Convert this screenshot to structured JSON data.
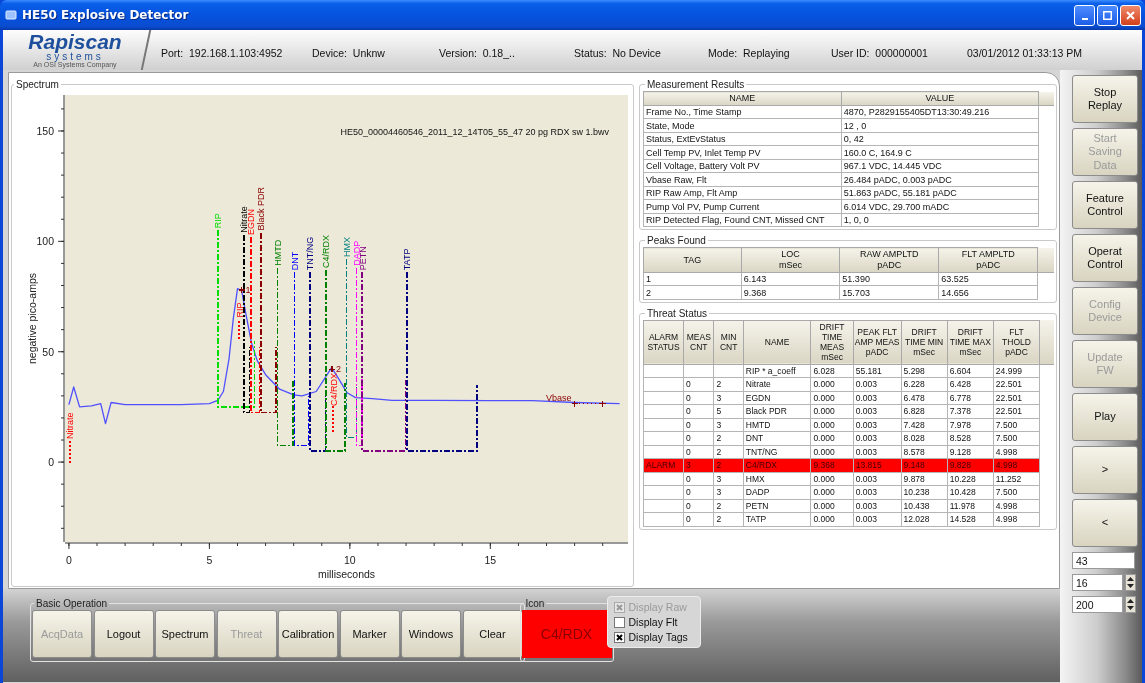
{
  "window": {
    "title": "HE50 Explosive Detector"
  },
  "header": {
    "logo": {
      "name": "Rapiscan",
      "subtitle": "systems",
      "tagline": "An OSI Systems Company"
    },
    "info": [
      "Port:  192.168.1.103:4952",
      "Device:  Unknw",
      "Version:  0.18_..",
      "Status:  No Device",
      "Mode:  Replaying",
      "User ID:  000000001",
      "03/01/2012 01:33:13 PM"
    ]
  },
  "spectrum": {
    "title": "Spectrum",
    "chart_data": {
      "type": "line",
      "title": "HE50_00004460546_2011_12_14T05_55_47 20 pg RDX sw 1.bwv",
      "xlabel": "milliseconds",
      "ylabel": "negative pico-amps",
      "xlim": [
        -0.14,
        19.9
      ],
      "ylim": [
        -36.2,
        166.3
      ],
      "xticks": [
        0,
        5,
        10,
        15
      ],
      "yticks": [
        0,
        50,
        100,
        150
      ],
      "x": [
        0,
        0.17,
        0.38,
        0.8,
        1.13,
        1.3,
        1.5,
        2,
        3,
        4,
        5,
        5.3,
        5.5,
        5.7,
        5.85,
        6,
        6.15,
        6.3,
        6.5,
        6.7,
        7,
        7.5,
        8,
        8.3,
        8.8,
        9.1,
        9.35,
        9.6,
        9.9,
        10.2,
        10.8,
        11.5,
        13,
        15,
        16.5,
        18,
        19.6
      ],
      "series": [
        {
          "color": "#5050ff",
          "values": [
            26,
            34,
            25,
            25.5,
            26.5,
            17.4,
            27,
            26,
            26,
            26,
            26.5,
            28,
            32,
            47,
            65,
            78.6,
            77.7,
            67,
            54,
            46,
            39.6,
            33,
            30.5,
            30,
            32,
            37.8,
            42.8,
            37.8,
            31.4,
            29.2,
            28.7,
            28,
            28,
            27.8,
            27.8,
            27,
            26.5
          ]
        }
      ]
    },
    "markers": [
      {
        "kind": "gate",
        "text": "RIP",
        "color": "#00dd00"
      },
      {
        "kind": "gate",
        "text": "Nitrate",
        "color": "#000000"
      },
      {
        "kind": "gate",
        "text": "EGDN",
        "color": "#ff0000"
      },
      {
        "kind": "gate",
        "text": "Black PDR",
        "color": "#8b0000"
      },
      {
        "kind": "gate",
        "text": "HMTD",
        "color": "#008000"
      },
      {
        "kind": "gate",
        "text": "DNT",
        "color": "#0000ff"
      },
      {
        "kind": "gate",
        "text": "TNT/NG",
        "color": "#000080"
      },
      {
        "kind": "gate",
        "text": "C4/RDX",
        "color": "#008000"
      },
      {
        "kind": "gate",
        "text": "HMX",
        "color": "#008080"
      },
      {
        "kind": "gate",
        "text": "DADP",
        "color": "#ff00ff"
      },
      {
        "kind": "gate",
        "text": "PETN",
        "color": "#800080"
      },
      {
        "kind": "gate",
        "text": "TATP",
        "color": "#000080"
      },
      {
        "kind": "tag",
        "text": "Nitrate",
        "color": "#ff0000"
      },
      {
        "kind": "tag",
        "text": "RIP",
        "color": "#ff0000"
      },
      {
        "kind": "tag",
        "text": "C4/RDX",
        "color": "#ff0000"
      },
      {
        "kind": "peak",
        "text": "1",
        "color": "#8b0000"
      },
      {
        "kind": "peak",
        "text": "2",
        "color": "#8b0000"
      },
      {
        "kind": "vbase",
        "text": "Vbase",
        "color": "#8b0000"
      }
    ]
  },
  "measurement_results": {
    "title": "Measurement Results",
    "columns": [
      "NAME",
      "VALUE"
    ],
    "rows": [
      [
        "Frame No., Time Stamp",
        "4870, P2829155405DT13:30:49.216"
      ],
      [
        "State, Mode",
        "12 , 0"
      ],
      [
        "Status, ExtEvStatus",
        "0, 42"
      ],
      [
        "Cell Temp PV, Inlet Temp PV",
        "160.0 C, 164.9 C"
      ],
      [
        "Cell Voltage, Battery Volt PV",
        "967.1 VDC, 14.445 VDC"
      ],
      [
        "Vbase Raw, Flt",
        "26.484 pADC, 0.003 pADC"
      ],
      [
        "RIP Raw Amp, Flt Amp",
        "51.863 pADC, 55.181 pADC"
      ],
      [
        "Pump Vol PV,  Pump Current",
        "6.014 VDC, 29.700 mADC"
      ],
      [
        "RIP Detected Flag, Found CNT, Missed CNT",
        "1, 0, 0"
      ]
    ]
  },
  "peaks_found": {
    "title": "Peaks Found",
    "columns": [
      "TAG",
      "LOC\nmSec",
      "RAW AMPLTD\npADC",
      "FLT AMPLTD\npADC"
    ],
    "rows": [
      [
        "1",
        "6.143",
        "51.390",
        "63.525"
      ],
      [
        "2",
        "9.368",
        "15.703",
        "14.656"
      ]
    ]
  },
  "threat_status": {
    "title": "Threat Status",
    "columns": [
      "ALARM\nSTATUS",
      "MEAS\nCNT",
      "MIN\nCNT",
      "NAME",
      "DRIFT\nTIME MEAS\nmSec",
      "PEAK FLT\nAMP MEAS\npADC",
      "DRIFT\nTIME MIN\nmSec",
      "DRIFT\nTIME MAX\nmSec",
      "FLT\nTHOLD\npADC"
    ],
    "rows": [
      {
        "alarm": false,
        "cells": [
          null,
          null,
          null,
          "RIP * a_coeff",
          "6.028",
          "55.181",
          "5.298",
          "6.604",
          "24.999"
        ]
      },
      {
        "alarm": false,
        "cells": [
          null,
          "0",
          "2",
          "Nitrate",
          "0.000",
          "0.003",
          "6.228",
          "6.428",
          "22.501"
        ]
      },
      {
        "alarm": false,
        "cells": [
          null,
          "0",
          "3",
          "EGDN",
          "0.000",
          "0.003",
          "6.478",
          "6.778",
          "22.501"
        ]
      },
      {
        "alarm": false,
        "cells": [
          null,
          "0",
          "5",
          "Black PDR",
          "0.000",
          "0.003",
          "6.828",
          "7.378",
          "22.501"
        ]
      },
      {
        "alarm": false,
        "cells": [
          null,
          "0",
          "3",
          "HMTD",
          "0.000",
          "0.003",
          "7.428",
          "7.978",
          "7.500"
        ]
      },
      {
        "alarm": false,
        "cells": [
          null,
          "0",
          "2",
          "DNT",
          "0.000",
          "0.003",
          "8.028",
          "8.528",
          "7.500"
        ]
      },
      {
        "alarm": false,
        "cells": [
          null,
          "0",
          "2",
          "TNT/NG",
          "0.000",
          "0.003",
          "8.578",
          "9.128",
          "4.998"
        ]
      },
      {
        "alarm": true,
        "cells": [
          "ALARM",
          "3",
          "2",
          "C4/RDX",
          "9.368",
          "13.815",
          "9.148",
          "9.828",
          "4.998"
        ]
      },
      {
        "alarm": false,
        "cells": [
          null,
          "0",
          "3",
          "HMX",
          "0.000",
          "0.003",
          "9.878",
          "10.228",
          "11.252"
        ]
      },
      {
        "alarm": false,
        "cells": [
          null,
          "0",
          "3",
          "DADP",
          "0.000",
          "0.003",
          "10.238",
          "10.428",
          "7.500"
        ]
      },
      {
        "alarm": false,
        "cells": [
          null,
          "0",
          "2",
          "PETN",
          "0.000",
          "0.003",
          "10.438",
          "11.978",
          "4.998"
        ]
      },
      {
        "alarm": false,
        "cells": [
          null,
          "0",
          "2",
          "TATP",
          "0.000",
          "0.003",
          "12.028",
          "14.528",
          "4.998"
        ]
      }
    ]
  },
  "side_buttons": [
    {
      "label": "Stop\nReplay",
      "disabled": false
    },
    {
      "label": "Start\nSaving\nData",
      "disabled": true
    },
    {
      "label": "Feature\nControl",
      "disabled": false
    },
    {
      "label": "Operat\nControl",
      "disabled": false
    },
    {
      "label": "Config\nDevice",
      "disabled": true
    },
    {
      "label": "Update\nFW",
      "disabled": true
    },
    {
      "label": "Play",
      "disabled": false
    },
    {
      "label": ">",
      "disabled": false
    },
    {
      "label": "<",
      "disabled": false
    }
  ],
  "side_fields": [
    {
      "kind": "text",
      "value": "43"
    },
    {
      "kind": "spinner",
      "value": "16"
    },
    {
      "kind": "spinner",
      "value": "200"
    }
  ],
  "basic_operation": {
    "title": "Basic Operation",
    "buttons": [
      {
        "label": "AcqData",
        "disabled": true
      },
      {
        "label": "Logout",
        "disabled": false
      },
      {
        "label": "Spectrum",
        "disabled": false
      },
      {
        "label": "Threat",
        "disabled": true
      },
      {
        "label": "Calibration",
        "disabled": false
      },
      {
        "label": "Marker",
        "disabled": false
      },
      {
        "label": "Windows",
        "disabled": false
      },
      {
        "label": "Clear",
        "disabled": false
      }
    ]
  },
  "icon_panel": {
    "title": "Icon",
    "text": "C4/RDX",
    "alarm": true
  },
  "display_options": [
    {
      "label": "Display Raw",
      "checked": true,
      "disabled": true
    },
    {
      "label": "Display Flt",
      "checked": false,
      "disabled": false
    },
    {
      "label": "Display Tags",
      "checked": true,
      "disabled": false
    }
  ]
}
